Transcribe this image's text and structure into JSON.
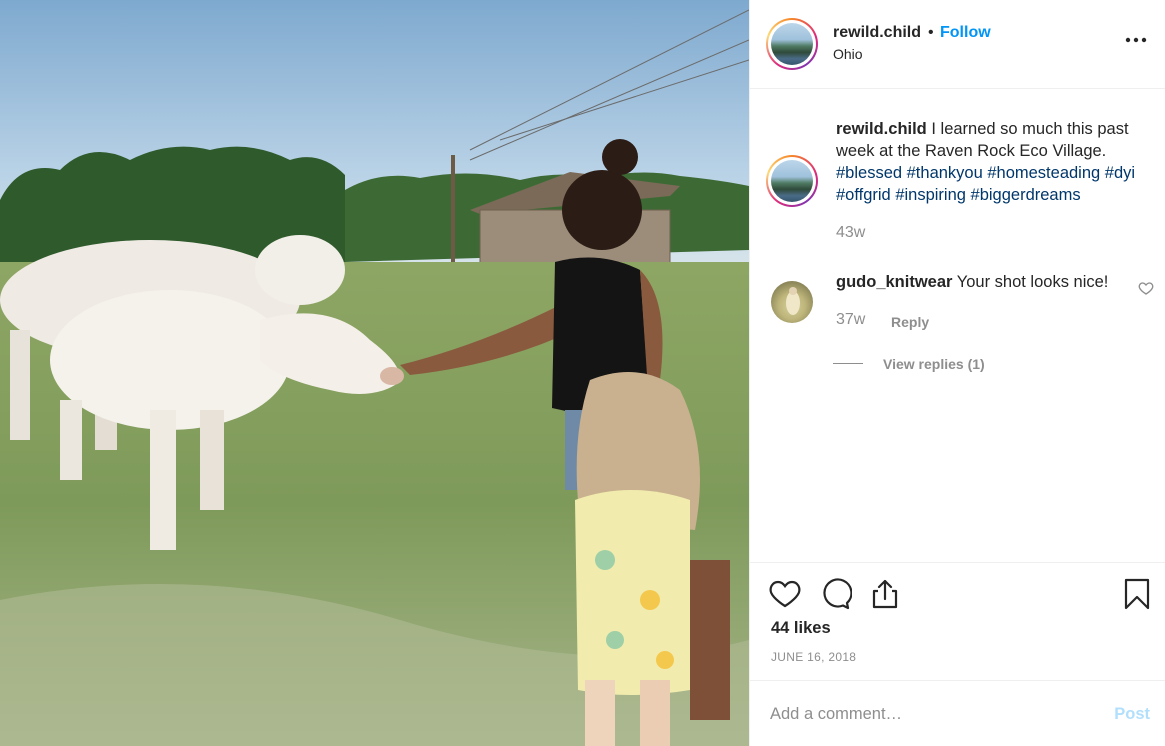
{
  "post": {
    "username": "rewild.child",
    "separator": "•",
    "follow_label": "Follow",
    "location": "Ohio",
    "more_icon": "more-horizontal-icon"
  },
  "caption": {
    "username": "rewild.child",
    "text": "I learned so much this past week at the Raven Rock Eco Village.",
    "hashtags": "#blessed #thankyou #homesteading #dyi #offgrid #inspiring #biggerdreams",
    "time": "43w"
  },
  "comments": [
    {
      "username": "gudo_knitwear",
      "text": "Your shot looks nice!",
      "time": "37w",
      "reply_label": "Reply",
      "view_replies_label": "View replies (1)"
    }
  ],
  "actions": {
    "like_icon": "heart-icon",
    "comment_icon": "comment-icon",
    "share_icon": "share-icon",
    "save_icon": "bookmark-icon",
    "likes": "44 likes",
    "date": "JUNE 16, 2018"
  },
  "add_comment": {
    "placeholder": "Add a comment…",
    "post_label": "Post"
  },
  "colors": {
    "accent_blue": "#0095f6",
    "hashtag_blue": "#00376b",
    "muted_gray": "#8e8e8e",
    "post_disabled": "#b2dffc"
  }
}
